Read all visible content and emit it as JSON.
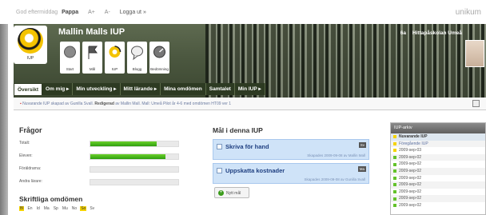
{
  "topbar": {
    "greeting": "God eftermiddag",
    "user": "Pappa",
    "font_size_label": "A+",
    "font_size_small": "A-",
    "logout": "Logga ut »",
    "brand": "unikum"
  },
  "header": {
    "title": "Mallin Malls IUP",
    "class": "6a",
    "school": "Hittapåskolan",
    "city": "Umeå",
    "logo_label": "IUP",
    "icon_buttons": [
      {
        "label": "Start",
        "icon": "circle-icon"
      },
      {
        "label": "Mål",
        "icon": "flag-icon"
      },
      {
        "label": "IUP",
        "icon": "iup-icon"
      },
      {
        "label": "Blogg",
        "icon": "speech-bubble-icon"
      },
      {
        "label": "Bedömning",
        "icon": "gauge-icon"
      }
    ]
  },
  "nav": {
    "tabs": [
      {
        "label": "Översikt",
        "active": true
      },
      {
        "label": "Om mig ▸"
      },
      {
        "label": "Min utveckling ▸"
      },
      {
        "label": "Mitt lärande ▸"
      },
      {
        "label": "Mina omdömen"
      },
      {
        "label": "Samtalet"
      },
      {
        "label": "Min IUP ▸"
      }
    ]
  },
  "breadcrumb": {
    "bullet": "▪",
    "prefix": "Nuvarande IUP skapad av Gunilla Svall.",
    "bold": "Redigerad",
    "suffix": "av Mallin Mall. Mall: Umeå Pilot år 4-6 med omdömen HT09 ver 1"
  },
  "fragor": {
    "heading": "Frågor",
    "rows": [
      {
        "label": "Totalt:",
        "progress": 0.75
      },
      {
        "label": "Eleven:",
        "progress": 0.85
      },
      {
        "label": "Föräldrarna:",
        "progress": 0.0
      },
      {
        "label": "Andra lärare:",
        "progress": 0.0
      }
    ]
  },
  "skriftliga": {
    "heading": "Skriftliga omdömen",
    "days": [
      {
        "label": "Bl",
        "highlight": true
      },
      {
        "label": "En"
      },
      {
        "label": "Id"
      },
      {
        "label": "Ma"
      },
      {
        "label": "Sp"
      },
      {
        "label": "Mu"
      },
      {
        "label": "No"
      },
      {
        "label": "So",
        "highlight": true
      },
      {
        "label": "Sv"
      }
    ]
  },
  "mal": {
    "heading": "Mål i denna IUP",
    "goals": [
      {
        "title": "Skriva för hand",
        "meta": "Skapades 2009-09-08 av Mallin Mall",
        "edit": "Sv"
      },
      {
        "title": "Uppskatta kostnader",
        "meta": "Skapades 2009-09-08 av Gunilla Svall",
        "edit": "Ma"
      }
    ],
    "new_goal": "Nytt mål"
  },
  "arkiv": {
    "heading": "IUP-arkiv",
    "items": [
      {
        "label": "Nuvarande IUP",
        "kind": "current"
      },
      {
        "label": "Föregående IUP",
        "kind": "prev"
      },
      {
        "label": "2009-sep-03"
      },
      {
        "label": "2009-sep-02",
        "kind": "green"
      },
      {
        "label": "2009-sep-02",
        "kind": "green"
      },
      {
        "label": "2009-sep-02",
        "kind": "green"
      },
      {
        "label": "2009-sep-02",
        "kind": "green"
      },
      {
        "label": "2009-sep-02",
        "kind": "green"
      },
      {
        "label": "2009-sep-02",
        "kind": "green"
      },
      {
        "label": "2009-sep-02",
        "kind": "green"
      },
      {
        "label": "2009-sep-02",
        "kind": "green"
      }
    ]
  },
  "colors": {
    "header_green": "#2d3a22",
    "progress_green": "#2e9e10",
    "accent_yellow": "#f5d300",
    "goal_blue": "#cfe3f8"
  }
}
